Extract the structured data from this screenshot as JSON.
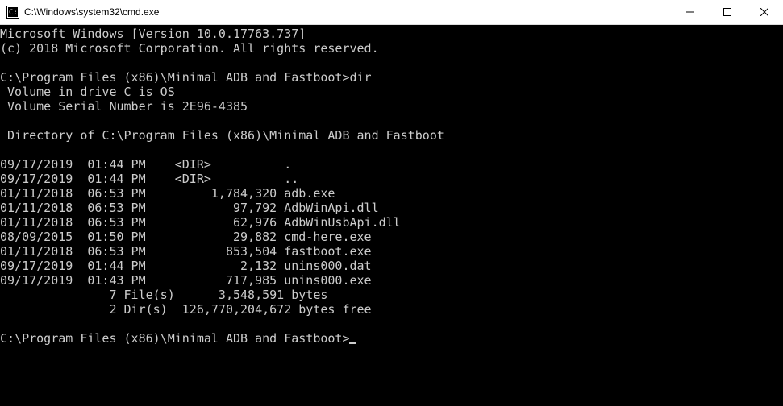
{
  "window": {
    "title": "C:\\Windows\\system32\\cmd.exe"
  },
  "terminal": {
    "header_line1": "Microsoft Windows [Version 10.0.17763.737]",
    "header_line2": "(c) 2018 Microsoft Corporation. All rights reserved.",
    "prompt1_path": "C:\\Program Files (x86)\\Minimal ADB and Fastboot>",
    "prompt1_cmd": "dir",
    "vol_line": " Volume in drive C is OS",
    "vol_serial": " Volume Serial Number is 2E96-4385",
    "dir_of": " Directory of C:\\Program Files (x86)\\Minimal ADB and Fastboot",
    "entries": [
      "09/17/2019  01:44 PM    <DIR>          .",
      "09/17/2019  01:44 PM    <DIR>          ..",
      "01/11/2018  06:53 PM         1,784,320 adb.exe",
      "01/11/2018  06:53 PM            97,792 AdbWinApi.dll",
      "01/11/2018  06:53 PM            62,976 AdbWinUsbApi.dll",
      "08/09/2015  01:50 PM            29,882 cmd-here.exe",
      "01/11/2018  06:53 PM           853,504 fastboot.exe",
      "09/17/2019  01:44 PM             2,132 unins000.dat",
      "09/17/2019  01:43 PM           717,985 unins000.exe"
    ],
    "summary_files": "               7 File(s)      3,548,591 bytes",
    "summary_dirs": "               2 Dir(s)  126,770,204,672 bytes free",
    "prompt2_path": "C:\\Program Files (x86)\\Minimal ADB and Fastboot>"
  }
}
